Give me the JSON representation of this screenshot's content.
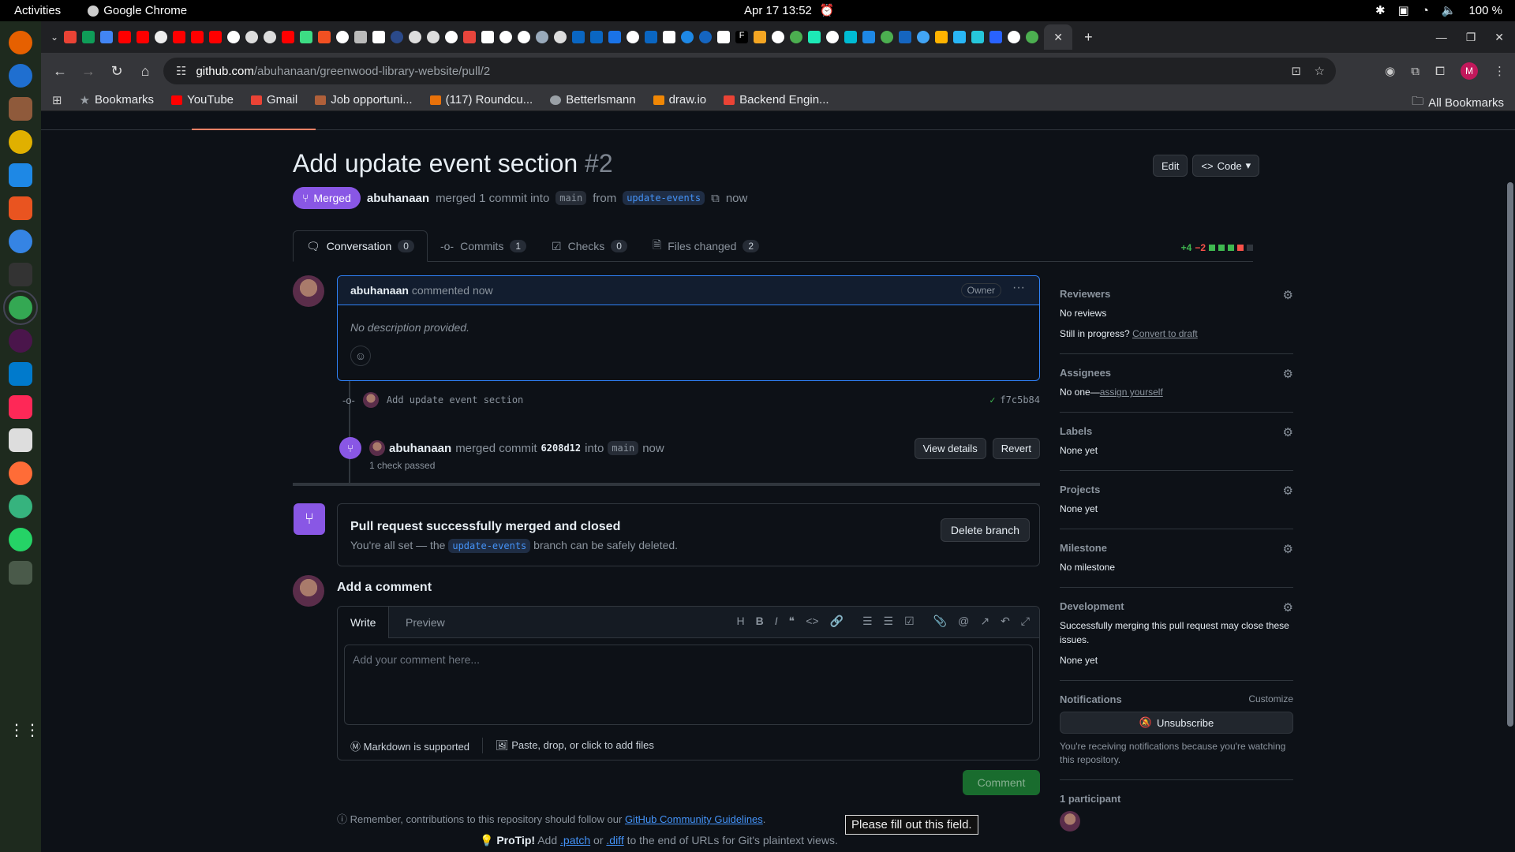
{
  "system": {
    "activities": "Activities",
    "app_name": "Google Chrome",
    "date_time": "Apr 17  13:52",
    "battery": "100 %"
  },
  "browser": {
    "url_host": "github.com",
    "url_path": "/abuhanaan/greenwood-library-website/pull/2",
    "profile_initial": "M",
    "bookmarks": [
      {
        "label": "Bookmarks",
        "color": "#9aa0a6"
      },
      {
        "label": "YouTube",
        "color": "#ff0000"
      },
      {
        "label": "Gmail",
        "color": "#ea4335"
      },
      {
        "label": "Job opportuni...",
        "color": "#b0603a"
      },
      {
        "label": "(117) Roundcu...",
        "color": "#e8710a"
      },
      {
        "label": "Betterlsmann",
        "color": "#9aa0a6"
      },
      {
        "label": "draw.io",
        "color": "#f08705"
      },
      {
        "label": "Backend Engin...",
        "color": "#ea4335"
      }
    ],
    "all_bookmarks": "All Bookmarks"
  },
  "pr": {
    "title": "Add update event section",
    "number": "#2",
    "edit_label": "Edit",
    "code_label": "Code",
    "status": "Merged",
    "author": "abuhanaan",
    "merge_text": "merged 1 commit into",
    "base_branch": "main",
    "from_text": "from",
    "head_branch": "update-events",
    "time": "now"
  },
  "tabs": [
    {
      "label": "Conversation",
      "count": "0"
    },
    {
      "label": "Commits",
      "count": "1"
    },
    {
      "label": "Checks",
      "count": "0"
    },
    {
      "label": "Files changed",
      "count": "2"
    }
  ],
  "diffstat": {
    "additions": "+4",
    "deletions": "−2"
  },
  "comment": {
    "author": "abuhanaan",
    "action": "commented now",
    "role": "Owner",
    "body": "No description provided."
  },
  "commit": {
    "message": "Add update event section",
    "sha": "f7c5b84"
  },
  "merge_event": {
    "author": "abuhanaan",
    "action": "merged commit",
    "sha": "6208d12",
    "into": "into",
    "branch": "main",
    "time": "now",
    "checks": "1 check passed",
    "view_details": "View details",
    "revert": "Revert"
  },
  "merged_box": {
    "title": "Pull request successfully merged and closed",
    "prefix": "You're all set — the",
    "branch": "update-events",
    "suffix": "branch can be safely deleted.",
    "delete_label": "Delete branch"
  },
  "add_comment": {
    "title": "Add a comment",
    "write_tab": "Write",
    "preview_tab": "Preview",
    "placeholder": "Add your comment here...",
    "tooltip": "Please fill out this field.",
    "markdown": "Markdown is supported",
    "files": "Paste, drop, or click to add files",
    "submit": "Comment"
  },
  "footer": {
    "remember_prefix": "Remember, contributions to this repository should follow our",
    "guidelines": "GitHub Community Guidelines",
    "protip_label": "ProTip!",
    "protip_add": "Add",
    "patch": ".patch",
    "or": "or",
    "diff": ".diff",
    "protip_suffix": "to the end of URLs for Git's plaintext views."
  },
  "sidebar": {
    "reviewers_title": "Reviewers",
    "reviewers_value": "No reviews",
    "progress_prefix": "Still in progress?",
    "convert_draft": "Convert to draft",
    "assignees_title": "Assignees",
    "assignees_prefix": "No one—",
    "assign_yourself": "assign yourself",
    "labels_title": "Labels",
    "labels_value": "None yet",
    "projects_title": "Projects",
    "projects_value": "None yet",
    "milestone_title": "Milestone",
    "milestone_value": "No milestone",
    "development_title": "Development",
    "development_text": "Successfully merging this pull request may close these issues.",
    "development_value": "None yet",
    "notifications_title": "Notifications",
    "customize": "Customize",
    "unsubscribe": "Unsubscribe",
    "notify_text": "You're receiving notifications because you're watching this repository.",
    "participants": "1 participant"
  }
}
